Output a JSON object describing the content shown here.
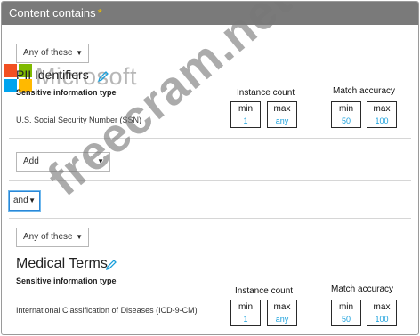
{
  "header": {
    "title": "Content contains",
    "required_mark": "*"
  },
  "watermark": {
    "text": "freecram.net"
  },
  "logo": {
    "text": "Microsoft",
    "colors": [
      "#f25022",
      "#7fba00",
      "#00a4ef",
      "#ffb900"
    ]
  },
  "group1": {
    "match_select": "Any of these",
    "title": "PII Identifiers",
    "sensitive_label": "Sensitive information type",
    "instance_count_label": "Instance count",
    "match_accuracy_label": "Match accuracy",
    "row": {
      "name": "U.S. Social Security Number (SSN)",
      "instance_min_label": "min",
      "instance_min": "1",
      "instance_max_label": "max",
      "instance_max": "any",
      "accuracy_min_label": "min",
      "accuracy_min": "50",
      "accuracy_max_label": "max",
      "accuracy_max": "100"
    },
    "add_select": "Add"
  },
  "operator_select": "and",
  "group2": {
    "match_select": "Any of these",
    "title": "Medical Terms",
    "sensitive_label": "Sensitive information type",
    "instance_count_label": "Instance count",
    "match_accuracy_label": "Match accuracy",
    "row": {
      "name": "International Classification of Diseases (ICD-9-CM)",
      "instance_min_label": "min",
      "instance_min": "1",
      "instance_max_label": "max",
      "instance_max": "any",
      "accuracy_min_label": "min",
      "accuracy_min": "50",
      "accuracy_max_label": "max",
      "accuracy_max": "100"
    }
  },
  "colors": {
    "accent": "#1aa0dc",
    "focus": "#2b88d8",
    "header": "#7a7a7a",
    "required": "#f0c000"
  }
}
